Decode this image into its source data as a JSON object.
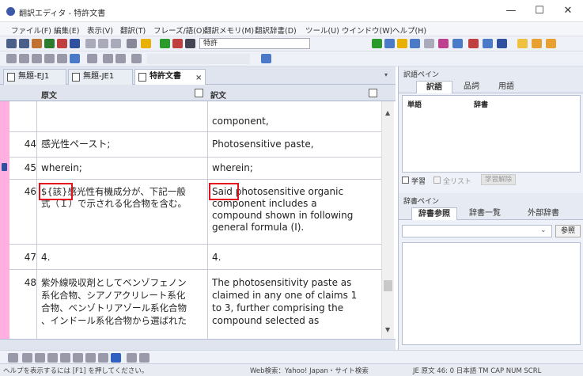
{
  "window": {
    "title": "翻訳エディタ - 特許文書",
    "min": "—",
    "max": "☐",
    "close": "✕"
  },
  "menu": [
    "ファイル(F)",
    "編集(E)",
    "表示(V)",
    "翻訳(T)",
    "フレーズ/語(O)",
    "翻訳メモリ(M)",
    "翻訳辞書(D)",
    "ツール(U)",
    "ウインドウ(W)",
    "ヘルプ(H)"
  ],
  "toolbar": {
    "mode_label": "特許"
  },
  "tabs": [
    {
      "label": "無題-EJ1",
      "active": false
    },
    {
      "label": "無題-JE1",
      "active": false
    },
    {
      "label": "特許文書",
      "active": true
    }
  ],
  "tab_close": "×",
  "columns": {
    "source": "原文",
    "target": "訳文"
  },
  "rows": [
    {
      "num": "",
      "source": [
        ""
      ],
      "target": [
        "component,"
      ]
    },
    {
      "num": "44",
      "source": [
        "感光性ペースト;"
      ],
      "target": [
        "Photosensitive paste,"
      ]
    },
    {
      "num": "45",
      "source": [
        "wherein;"
      ],
      "target": [
        "wherein;"
      ]
    },
    {
      "num": "46",
      "source": [
        "${該}感光性有機成分が、下記一般",
        "式（Ｉ）で示される化合物を含む。"
      ],
      "target": [
        "Said photosensitive organic",
        "component includes a",
        "compound shown in following",
        "general formula (I)."
      ]
    },
    {
      "num": "47",
      "source": [
        "4."
      ],
      "target": [
        "4."
      ]
    },
    {
      "num": "48",
      "source": [
        "紫外線吸収剤としてベンゾフェノン",
        "系化合物、シアノアクリレート系化",
        "合物、ベンゾトリアゾール系化合物",
        "、インドール系化合物から選ばれた"
      ],
      "target": [
        "The photosensitivity paste as",
        "claimed in any one of claims 1",
        "to 3, further comprising the",
        "compound selected as"
      ]
    }
  ],
  "right_panel": {
    "translation_pane": {
      "title": "訳語ペイン",
      "tabs": [
        "訳語",
        "品詞",
        "用語"
      ],
      "columns": [
        "単語",
        "辞書"
      ],
      "learn_label": "学習",
      "all_list_label": "全リスト",
      "learn_button": "学習解除"
    },
    "dict_pane": {
      "title": "辞書ペイン",
      "tabs": [
        "辞書参照",
        "辞書一覧",
        "外部辞書"
      ],
      "ref_button": "参照"
    }
  },
  "status": {
    "help": "ヘルプを表示するには [F1] を押してください。",
    "web": "Web検索：Yahoo! Japan・サイト検索",
    "mode": "JE 原文  46:  0  日本語  TM  CAP NUM SCRL"
  },
  "colors": {
    "accent": "#e3121e",
    "pink": "#ffb0e0",
    "blue": "#3a5aa8"
  }
}
